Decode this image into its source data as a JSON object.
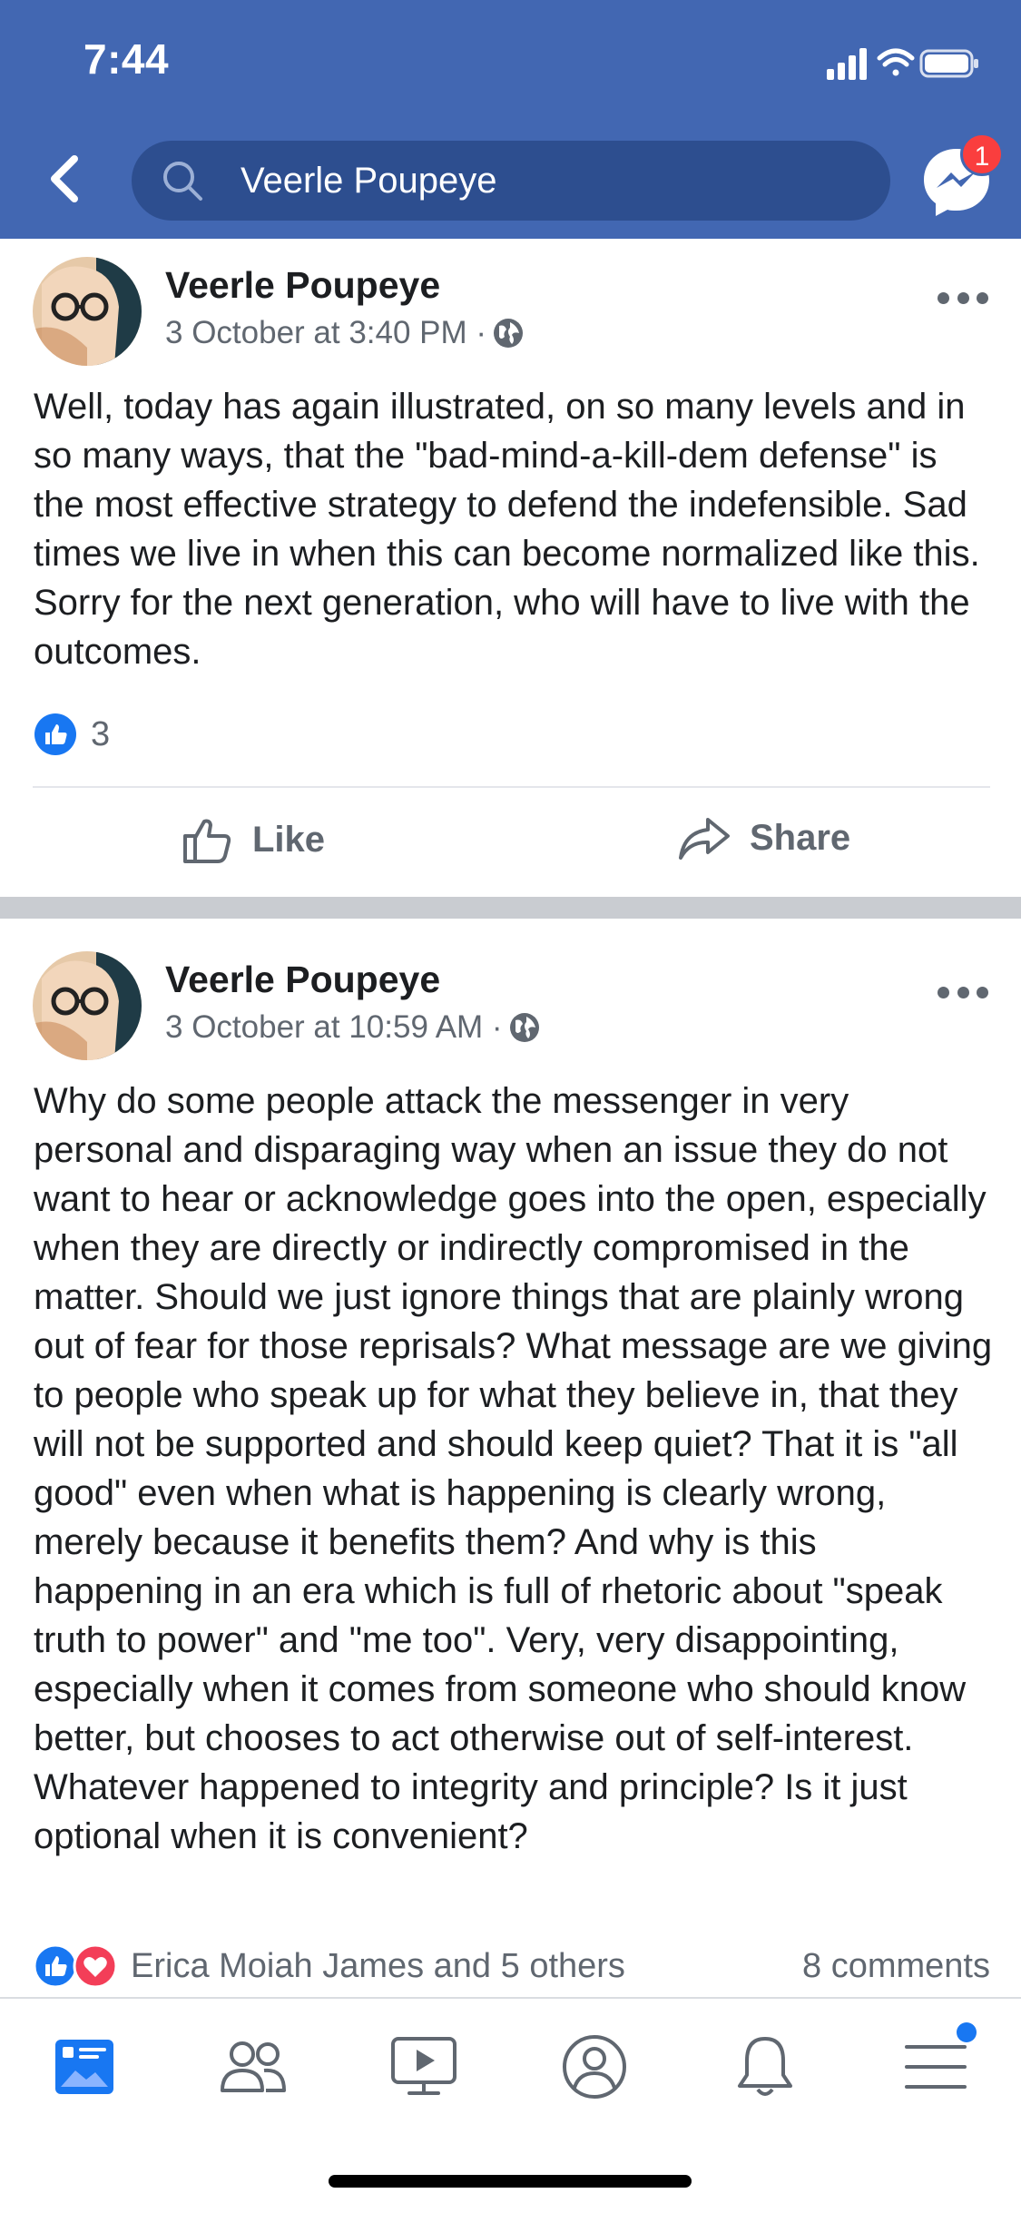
{
  "status_bar": {
    "time": "7:44"
  },
  "header": {
    "search_value": "Veerle Poupeye",
    "messenger_badge": "1",
    "colors": {
      "bar": "#4267b2",
      "search_field": "#2d4e8f",
      "badge": "#fa3e3e"
    }
  },
  "posts": [
    {
      "author": "Veerle Poupeye",
      "timestamp": "3 October at 3:40 PM ·",
      "text": "Well, today has again illustrated, on so many levels and in so many ways, that the \"bad-mind-a-kill-dem defense\" is the most effective strategy to defend the indefensible. Sad times we live in when this can become normalized like this. Sorry for the next generation, who will have to live with the outcomes.",
      "reaction_count": "3",
      "actions": {
        "like": "Like",
        "share": "Share"
      }
    },
    {
      "author": "Veerle Poupeye",
      "timestamp": "3 October at 10:59 AM ·",
      "text": "Why do some people attack the messenger in very personal and disparaging way when an issue they do not want to hear or acknowledge goes into the open, especially when they are directly or indirectly compromised in the matter. Should we just ignore things that are plainly wrong out of fear for those reprisals? What message are we giving to people who speak up for what they believe in, that they will not be supported and should keep quiet? That it is \"all good\" even when what is happening is clearly wrong, merely because it benefits them? And why is this happening in an era which is full of rhetoric about \"speak truth to power\" and \"me too\". Very, very disappointing, especially when it comes from someone who should know better, but chooses to act otherwise out of self-interest. Whatever happened to integrity and principle? Is it just optional when it is convenient?",
      "reactions_summary": "Erica Moiah James and 5 others",
      "comments_count": "8 comments"
    }
  ],
  "tabbar": {
    "icons": [
      "news-feed-icon",
      "friends-icon",
      "watch-icon",
      "profile-icon",
      "notifications-icon",
      "menu-icon"
    ],
    "active": "news-feed-icon",
    "accent": "#1877f2"
  }
}
